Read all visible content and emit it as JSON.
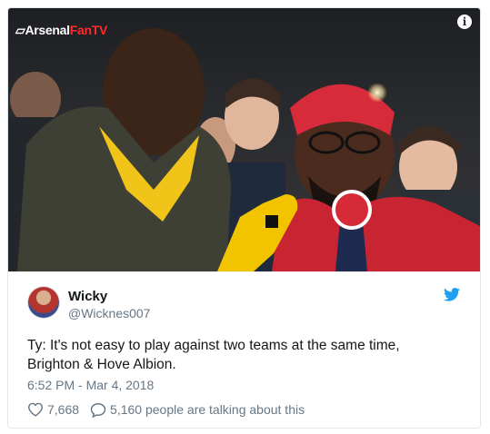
{
  "media": {
    "brand_prefix": "Arsenal",
    "brand_suffix": "FanTV",
    "info_symbol": "i"
  },
  "tweet": {
    "display_name": "Wicky",
    "screen_name": "@Wicknes007",
    "text_line1": "Ty: It's not easy to play against two teams at the same time,",
    "text_line2": "Brighton & Hove Albion.",
    "timestamp": "6:52 PM - Mar 4, 2018",
    "likes": "7,668",
    "talking": "5,160 people are talking about this"
  },
  "icons": {
    "brand": "tv-icon",
    "info": "info-icon",
    "platform": "twitter-bird-icon",
    "like": "heart-icon",
    "reply": "speech-bubble-icon"
  },
  "colors": {
    "accent": "#1da1f2",
    "brand_red": "#ff2b2b",
    "secondary_text": "#657786",
    "border": "#e1e8ed"
  }
}
